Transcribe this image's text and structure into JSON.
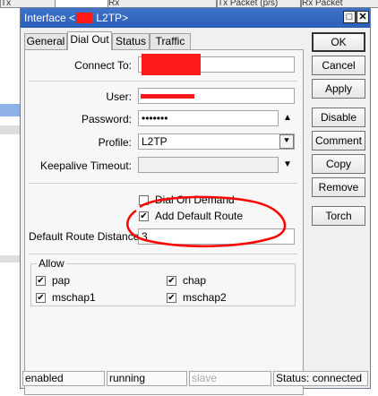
{
  "background": {
    "columns": [
      "Tx",
      "Rx",
      "Tx Packet (p/s)",
      "Rx Packet"
    ]
  },
  "window": {
    "title_prefix": "Interface <",
    "title_suffix": " L2TP>",
    "maximize_glyph": "□",
    "close_glyph": "✕"
  },
  "tabs": [
    "General",
    "Dial Out",
    "Status",
    "Traffic"
  ],
  "form": {
    "connect_to_label": "Connect To:",
    "connect_to_value": "",
    "user_label": "User:",
    "user_value": "",
    "password_label": "Password:",
    "password_value": "•••••••",
    "profile_label": "Profile:",
    "profile_value": "L2TP",
    "keepalive_label": "Keepalive Timeout:",
    "keepalive_value": "",
    "dial_on_demand_label": "Dial On Demand",
    "dial_on_demand_checked": false,
    "add_default_route_label": "Add Default Route",
    "add_default_route_checked": true,
    "route_distance_label": "Default Route Distance:",
    "route_distance_value": "3"
  },
  "allow": {
    "title": "Allow",
    "items": [
      {
        "label": "pap",
        "checked": true
      },
      {
        "label": "chap",
        "checked": true
      },
      {
        "label": "mschap1",
        "checked": true
      },
      {
        "label": "mschap2",
        "checked": true
      }
    ]
  },
  "buttons": [
    "OK",
    "Cancel",
    "Apply",
    "Disable",
    "Comment",
    "Copy",
    "Remove",
    "Torch"
  ],
  "statusbar": {
    "enabled": "enabled",
    "running": "running",
    "slave": "slave",
    "status": "Status: connected"
  },
  "colors": {
    "annotation": "#ff0000",
    "redaction": "#ff1a1a",
    "titlebar": "#2b5fb8"
  },
  "icons": {
    "spin_up": "▲",
    "spin_down": "▼",
    "dropdown": "⯆",
    "check": "✔"
  }
}
